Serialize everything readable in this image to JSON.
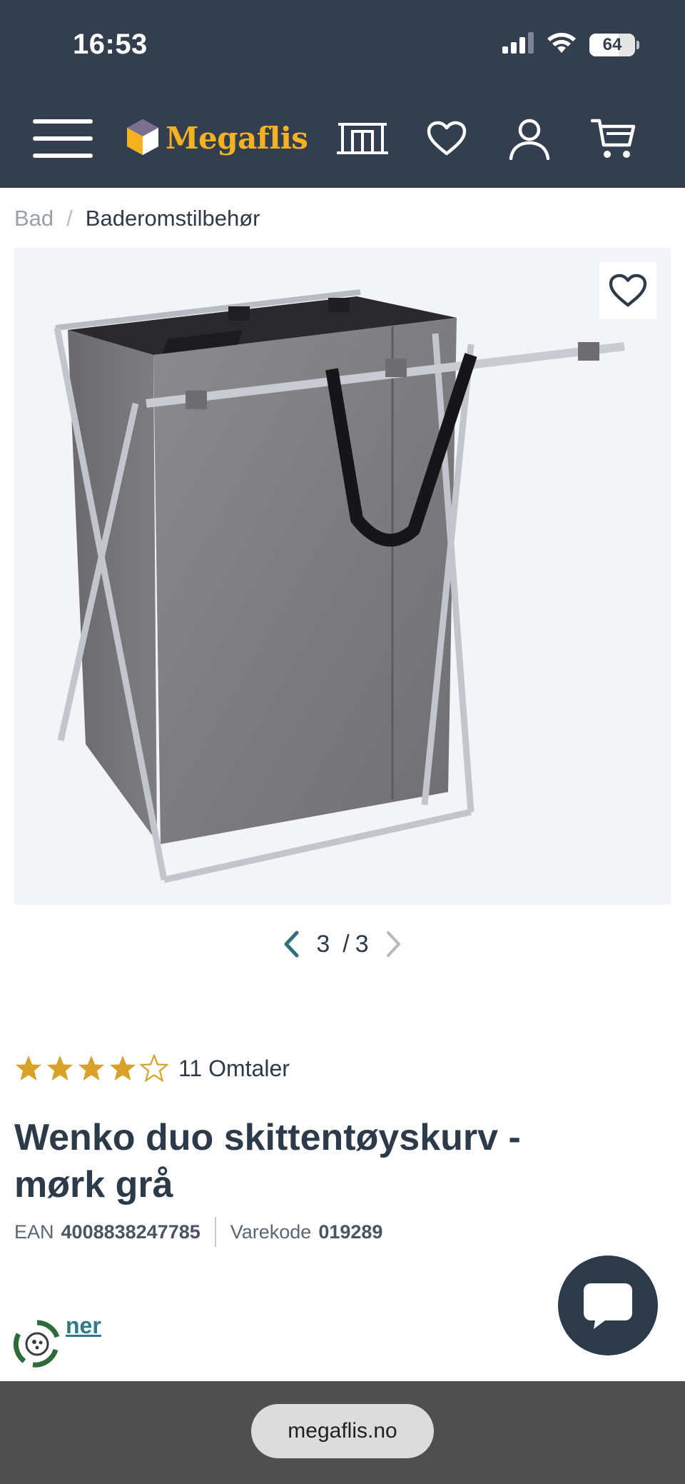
{
  "status_bar": {
    "time": "16:53",
    "battery": "64",
    "battery_level": 0.64
  },
  "header": {
    "logo_text": "Megaflis",
    "icons": [
      "menu-icon",
      "showroom-icon",
      "heart-icon",
      "user-icon",
      "cart-icon"
    ]
  },
  "breadcrumb": {
    "home": "Bad",
    "separator": "/",
    "current": "Baderomstilbehør"
  },
  "gallery": {
    "current": "3",
    "separator": "/",
    "total": "3"
  },
  "rating": {
    "value": 4,
    "max": 5,
    "reviews_label": "11 Omtaler"
  },
  "product": {
    "title": "Wenko duo skittentøyskurv - mørk grå",
    "ean_label": "EAN",
    "ean": "4008838247785",
    "sku_label": "Varekode",
    "sku": "019289"
  },
  "eco_link": "ner",
  "browser": {
    "url": "megaflis.no"
  },
  "colors": {
    "header_bg": "#333f4f",
    "brand_yellow": "#f4b223",
    "star": "#d8a128",
    "link": "#2f7a8a"
  }
}
